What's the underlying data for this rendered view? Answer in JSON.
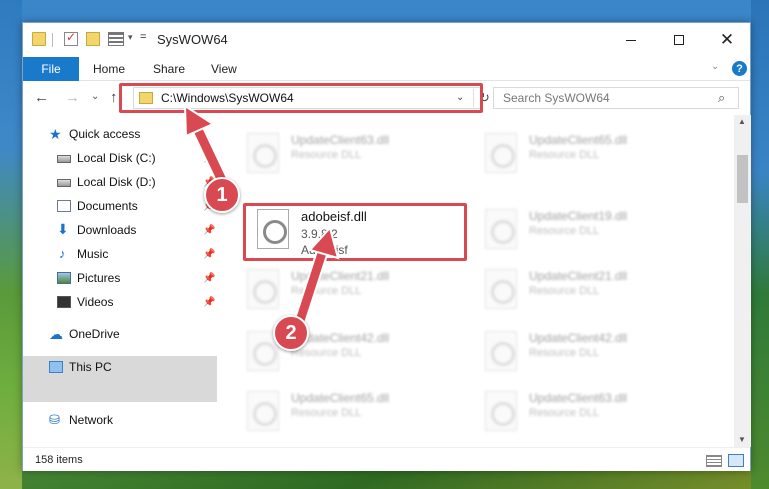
{
  "window": {
    "title": "SysWOW64"
  },
  "quick_access_toolbar": {
    "dropdown_glyph": "=",
    "caret_glyph": "▾"
  },
  "window_controls": {
    "close": "✕"
  },
  "ribbon": {
    "tabs": [
      "File",
      "Home",
      "Share",
      "View"
    ],
    "chevron": "⌄",
    "help": "?"
  },
  "nav_buttons": {
    "back": "←",
    "forward": "→",
    "recent": "⌄",
    "up": "↑"
  },
  "address": {
    "path": "C:\\Windows\\SysWOW64",
    "chevron": "⌄",
    "refresh": "↻"
  },
  "search": {
    "placeholder": "Search SysWOW64",
    "icon": "⌕"
  },
  "sidebar": {
    "items": [
      {
        "label": "Quick access",
        "icon": "star-icon",
        "glyph": "★",
        "pinned": false
      },
      {
        "label": "Local Disk (C:)",
        "icon": "drive-icon",
        "glyph": "",
        "pinned": true
      },
      {
        "label": "Local Disk (D:)",
        "icon": "drive-icon",
        "glyph": "",
        "pinned": true
      },
      {
        "label": "Documents",
        "icon": "documents-icon",
        "glyph": "",
        "pinned": true
      },
      {
        "label": "Downloads",
        "icon": "download-icon",
        "glyph": "⬇",
        "pinned": true
      },
      {
        "label": "Music",
        "icon": "music-icon",
        "glyph": "♪",
        "pinned": true
      },
      {
        "label": "Pictures",
        "icon": "pictures-icon",
        "glyph": "",
        "pinned": true
      },
      {
        "label": "Videos",
        "icon": "videos-icon",
        "glyph": "",
        "pinned": true
      },
      {
        "label": "OneDrive",
        "icon": "cloud-icon",
        "glyph": "☁",
        "pinned": false
      },
      {
        "label": "This PC",
        "icon": "computer-icon",
        "glyph": "",
        "pinned": false,
        "selected": true
      },
      {
        "label": "Network",
        "icon": "network-icon",
        "glyph": "⛁",
        "pinned": false
      }
    ],
    "pin_glyph": "📌"
  },
  "files": [
    {
      "name": "UpdateClient63.dll",
      "type": "Resource DLL",
      "blurred": true
    },
    {
      "name": "UpdateClient65.dll",
      "type": "Resource DLL",
      "blurred": true
    },
    {
      "name": "adobeisf.dll",
      "version": "3.9.8.2",
      "company": "Adobeisf",
      "blurred": false,
      "highlighted": true
    },
    {
      "name": "UpdateClient19.dll",
      "type": "Resource DLL",
      "blurred": true
    },
    {
      "name": "UpdateClient21.dll",
      "type": "Resource DLL",
      "blurred": true
    },
    {
      "name": "UpdateClient21.dll",
      "type": "Resource DLL",
      "blurred": true
    },
    {
      "name": "UpdateClient42.dll",
      "type": "Resource DLL",
      "blurred": true
    },
    {
      "name": "UpdateClient42.dll",
      "type": "Resource DLL",
      "blurred": true
    },
    {
      "name": "UpdateClient65.dll",
      "type": "Resource DLL",
      "blurred": true
    },
    {
      "name": "UpdateClient63.dll",
      "type": "Resource DLL",
      "blurred": true
    }
  ],
  "scrollbar": {
    "up": "▲",
    "down": "▼"
  },
  "status": {
    "item_count": "158 items"
  },
  "callouts": [
    {
      "number": "1"
    },
    {
      "number": "2"
    }
  ],
  "colors": {
    "accent": "#1979ca",
    "highlight": "#d94952",
    "selection": "#d9d9d9"
  }
}
